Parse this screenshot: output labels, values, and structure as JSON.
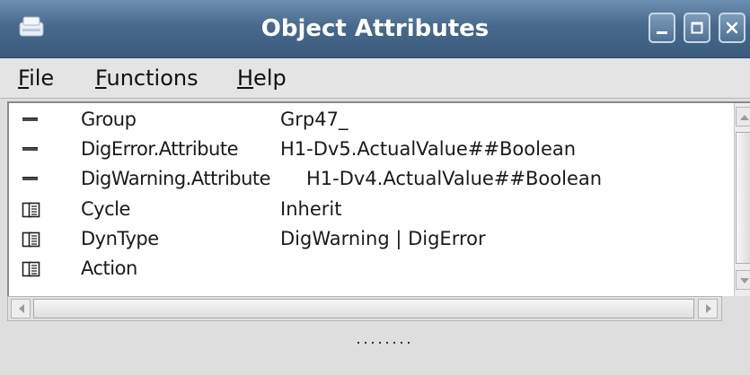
{
  "window": {
    "title": "Object Attributes",
    "icon": "app-icon",
    "controls": [
      "minimize-icon",
      "maximize-icon",
      "close-icon"
    ]
  },
  "menu": {
    "file": {
      "mnemonic": "F",
      "rest": "ile"
    },
    "functions": {
      "mnemonic": "F",
      "rest": "unctions"
    },
    "help": {
      "mnemonic": "H",
      "rest": "elp"
    }
  },
  "attributes": [
    {
      "icon": "attribute-icon",
      "name": "Group",
      "value": "Grp47_"
    },
    {
      "icon": "attribute-icon",
      "name": "DigError.Attribute",
      "value": "H1-Dv5.ActualValue##Boolean"
    },
    {
      "icon": "attribute-icon",
      "name": "DigWarning.Attribute",
      "value": "H1-Dv4.ActualValue##Boolean"
    },
    {
      "icon": "folder-icon",
      "name": "Cycle",
      "value": "Inherit"
    },
    {
      "icon": "folder-icon",
      "name": "DynType",
      "value": "DigWarning | DigError"
    },
    {
      "icon": "folder-icon",
      "name": "Action",
      "value": ""
    }
  ],
  "colors": {
    "titlebar": "#47698c",
    "title_text": "#ffffff",
    "list_background": "#ffffff",
    "window_background": "#dedede"
  }
}
